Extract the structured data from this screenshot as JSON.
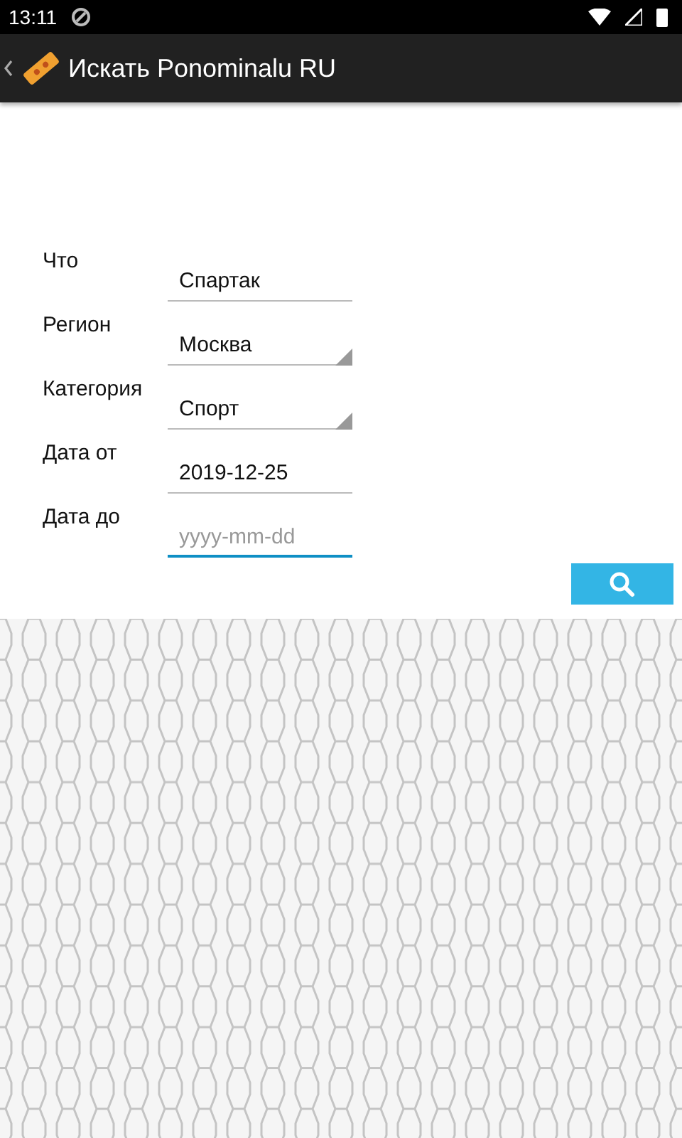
{
  "status_bar": {
    "time": "13:11"
  },
  "app_bar": {
    "title": "Искать Ponominalu RU"
  },
  "form": {
    "fields": [
      {
        "label": "Что",
        "kind": "text",
        "value": "Спартак",
        "focused": false
      },
      {
        "label": "Регион",
        "kind": "spinner",
        "value": "Москва",
        "focused": false
      },
      {
        "label": "Категория",
        "kind": "spinner",
        "value": "Спорт",
        "focused": false
      },
      {
        "label": "Дата от",
        "kind": "text",
        "value": "2019-12-25",
        "focused": false
      },
      {
        "label": "Дата до",
        "kind": "text",
        "placeholder": "yyyy-mm-dd",
        "focused": true
      }
    ]
  }
}
